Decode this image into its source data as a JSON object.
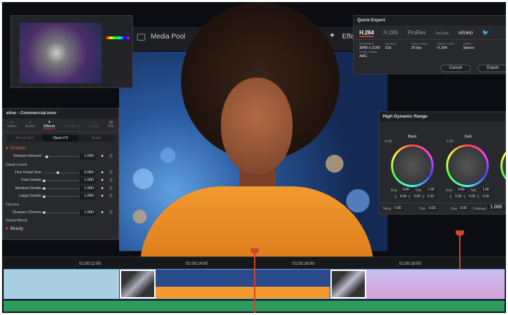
{
  "toolbar": {
    "media_pool": "Media Pool",
    "effects": "Effec"
  },
  "quick_export": {
    "title": "Quick Export",
    "formats": [
      "H.264",
      "H.265",
      "ProRes",
      "YouTube",
      "vimeo"
    ],
    "active_format": "H.264",
    "meta": [
      {
        "label": "Resolution",
        "value": "3840 x 2160"
      },
      {
        "label": "Duration",
        "value": "53s"
      },
      {
        "label": "Frame Rate",
        "value": "25 fps"
      },
      {
        "label": "Video Codec",
        "value": "H.264"
      },
      {
        "label": "Audio",
        "value": "Stereo"
      },
      {
        "label": "Audio Codec",
        "value": "AAC"
      }
    ],
    "cancel": "Cancel",
    "export": "Export"
  },
  "inspector": {
    "title": "eline - Commercial.mov",
    "tabs": [
      "Video",
      "Audio",
      "Effects",
      "Transition",
      "Image",
      "File"
    ],
    "active_tab": "Effects",
    "segments": [
      "ResolveFX",
      "Open FX",
      "Audio"
    ],
    "effect1": "Sharpen",
    "sharpen_amount": {
      "label": "Sharpen Amount",
      "value": "1.000"
    },
    "detail_levels": "Detail Levels",
    "fine_detail_size": {
      "label": "Fine Detail Size",
      "value": "0.050"
    },
    "fine_details": {
      "label": "Fine Details",
      "value": "1.000"
    },
    "medium_details": {
      "label": "Medium Details",
      "value": "1.000"
    },
    "large_details": {
      "label": "Large Details",
      "value": "1.000"
    },
    "chroma": "Chroma",
    "sharpen_chroma": {
      "label": "Sharpen Chroma",
      "value": "1.000"
    },
    "global_blend": "Global Blend",
    "effect2": "Beauty"
  },
  "hdr": {
    "title": "High Dynamic Range",
    "wheels": [
      {
        "name": "Black",
        "top": "-4.00",
        "exp": "0.00",
        "sat": "1.00",
        "x": "0.00",
        "y": "0.00",
        "z": "0.10"
      },
      {
        "name": "Dark",
        "top": "-1.00",
        "exp": "0.00",
        "sat": "1.00",
        "x": "0.00",
        "y": "0.00",
        "z": "0.20"
      }
    ],
    "labels": {
      "exp": "Exp",
      "sat": "Sat",
      "x": "X",
      "y": "Y",
      "z": "Z"
    },
    "bottom": {
      "temp_label": "Temp",
      "temp": "0.00",
      "tint_label": "Tint",
      "tint": "0.00",
      "hue_label": "Hue",
      "hue": "0.00",
      "contrast_label": "Contrast",
      "contrast": "1.000"
    }
  },
  "timeline": {
    "timecodes": [
      "01:00:12:00",
      "01:00:14:00",
      "01:00:16:00",
      "01:00:18:00"
    ]
  },
  "colors": {
    "accent": "#d4432c",
    "clip": "#3c70b8",
    "audio": "#2e9a5e",
    "sweater": "#f29a2e"
  }
}
